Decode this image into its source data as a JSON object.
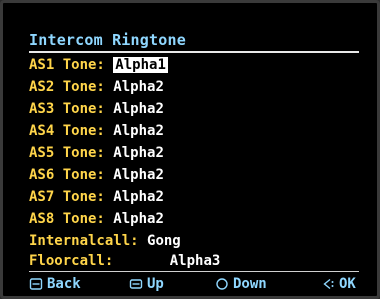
{
  "header": {
    "title": "Intercom Ringtone"
  },
  "tones": [
    {
      "label": "AS1 Tone:",
      "value": "Alpha1",
      "selected": true
    },
    {
      "label": "AS2 Tone:",
      "value": "Alpha2"
    },
    {
      "label": "AS3 Tone:",
      "value": "Alpha2"
    },
    {
      "label": "AS4 Tone:",
      "value": "Alpha2"
    },
    {
      "label": "AS5 Tone:",
      "value": "Alpha2"
    },
    {
      "label": "AS6 Tone:",
      "value": "Alpha2"
    },
    {
      "label": "AS7 Tone:",
      "value": "Alpha2"
    },
    {
      "label": "AS8 Tone:",
      "value": "Alpha2"
    }
  ],
  "internalcall": {
    "label": "Internalcall:",
    "value": "Gong"
  },
  "floorcall": {
    "label": "Floorcall:",
    "value": "Alpha3"
  },
  "footer": {
    "back_label": "Back",
    "up_label": "Up",
    "down_label": "Down",
    "ok_label": "OK",
    "back_icon": "back-key-icon",
    "up_icon": "up-key-icon",
    "down_icon": "down-key-icon",
    "ok_icon": "ok-key-icon"
  },
  "colors": {
    "title": "#8fd7ff",
    "label": "#ffd54a",
    "value": "#ffffff",
    "footer": "#8fd7ff"
  }
}
